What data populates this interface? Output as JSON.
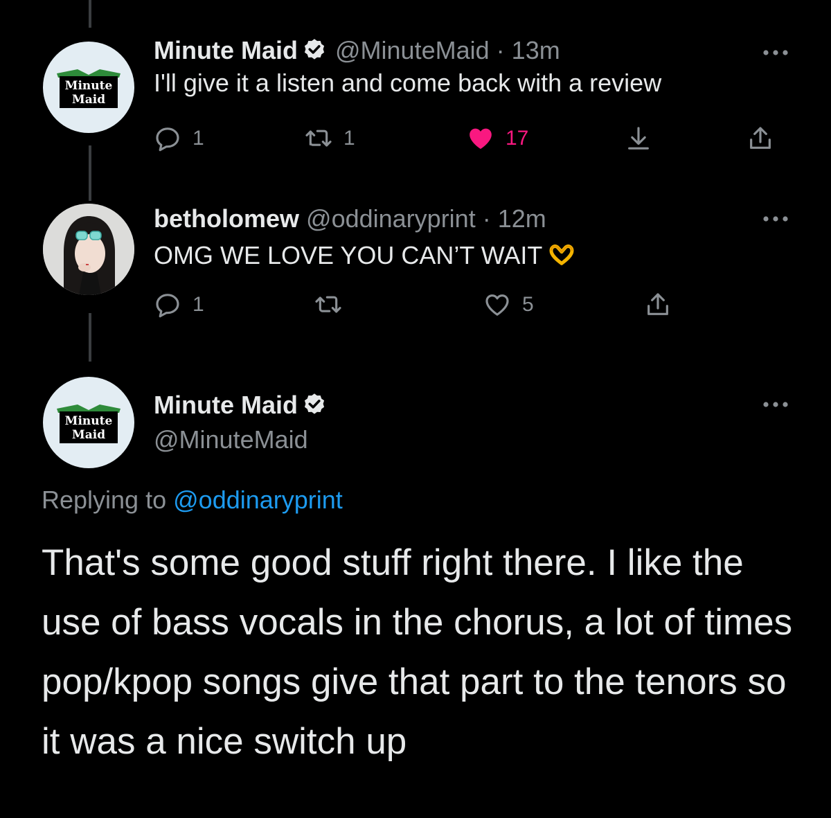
{
  "tweets": [
    {
      "name": "Minute Maid",
      "handle": "@MinuteMaid",
      "dot": "·",
      "time": "13m",
      "text": "I'll give it a listen and come back with a review",
      "avatar_text": [
        "Minute",
        "Maid"
      ],
      "replies": "1",
      "retweets": "1",
      "likes": "17",
      "liked": true
    },
    {
      "name": "betholomew",
      "handle": "@oddinaryprint",
      "dot": "·",
      "time": "12m",
      "text": "OMG WE LOVE YOU CAN’T WAIT",
      "emoji": "heart-hands-emoji",
      "replies": "1",
      "retweets": "",
      "likes": "5",
      "liked": false
    }
  ],
  "main_tweet": {
    "name": "Minute Maid",
    "handle": "@MinuteMaid",
    "avatar_text": [
      "Minute",
      "Maid"
    ],
    "replying_prefix": "Replying to",
    "replying_to": "@oddinaryprint",
    "text": "That's some good stuff right there. I like the use of bass vocals in the chorus, a lot of times pop/kpop songs give that part to the tenors so it was a nice switch up"
  },
  "colors": {
    "background": "#000000",
    "text": "#e7e9ea",
    "secondary": "#8b9095",
    "like_pink": "#f91880",
    "link_blue": "#1d9bf0",
    "thread_line": "#3a3d40",
    "brand_green": "#2e8b3a"
  },
  "icons": [
    "verified-badge-icon",
    "more-options-icon",
    "reply-icon",
    "retweet-icon",
    "like-icon",
    "download-icon",
    "share-icon"
  ]
}
